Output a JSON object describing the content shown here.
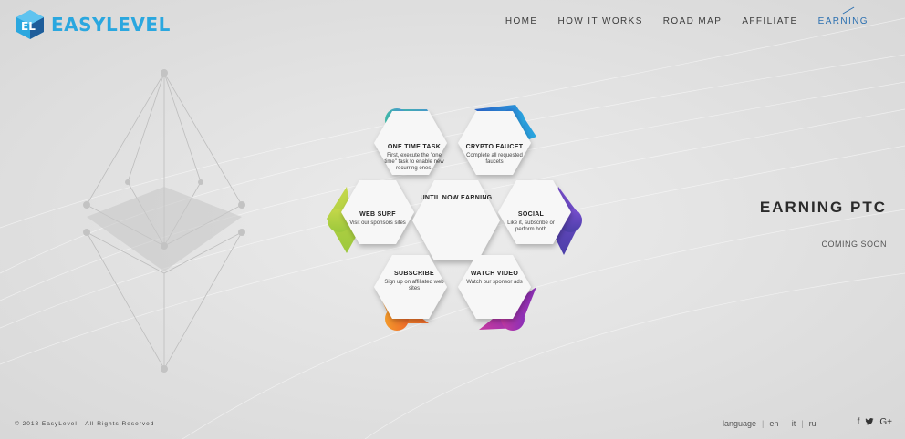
{
  "brand": {
    "name": "EASYLEVEL",
    "colors": {
      "primary": "#2aa7df",
      "dark": "#1e5d9a"
    }
  },
  "nav": {
    "items": [
      {
        "label": "HOME",
        "active": false
      },
      {
        "label": "HOW IT WORKS",
        "active": false
      },
      {
        "label": "ROAD MAP",
        "active": false
      },
      {
        "label": "AFFILIATE",
        "active": false
      },
      {
        "label": "EARNING",
        "active": true
      }
    ]
  },
  "center": {
    "title": "UNTIL NOW EARNING"
  },
  "cards": [
    {
      "key": "one_time_task",
      "title": "ONE TIME TASK",
      "desc": "First, execute the \"one time\" task to enable new recurring ones.",
      "color_a": "#3fbba8",
      "color_b": "#4e8ee0"
    },
    {
      "key": "crypto_faucet",
      "title": "CRYPTO FAUCET",
      "desc": "Complete all requested faucets",
      "color_a": "#2a63c8",
      "color_b": "#2aa7df"
    },
    {
      "key": "web_surf",
      "title": "WEB SURF",
      "desc": "Visit our sponsors sites",
      "color_a": "#c5d84a",
      "color_b": "#9cc83c"
    },
    {
      "key": "social",
      "title": "SOCIAL",
      "desc": "Like it, subscribe or perform both",
      "color_a": "#7a4fd1",
      "color_b": "#4b3fa8"
    },
    {
      "key": "subscribe",
      "title": "SUBSCRIBE",
      "desc": "Sign up on affiliated web sites",
      "color_a": "#f39a2b",
      "color_b": "#f06a2a"
    },
    {
      "key": "watch_video",
      "title": "WATCH VIDEO",
      "desc": "Watch our sponsor ads",
      "color_a": "#c43aa2",
      "color_b": "#8a2fb7"
    }
  ],
  "right": {
    "title": "EARNING PTC",
    "subtitle": "COMING SOON"
  },
  "footer": {
    "copyright": "© 2018 EasyLevel - All Rights Reserved",
    "language": {
      "label": "language",
      "options": [
        "en",
        "it",
        "ru"
      ],
      "active": "en"
    },
    "social": [
      {
        "icon": "facebook-icon",
        "glyph": "f"
      },
      {
        "icon": "twitter-icon",
        "glyph": "🐦"
      },
      {
        "icon": "google-plus-icon",
        "glyph": "G+"
      }
    ]
  }
}
